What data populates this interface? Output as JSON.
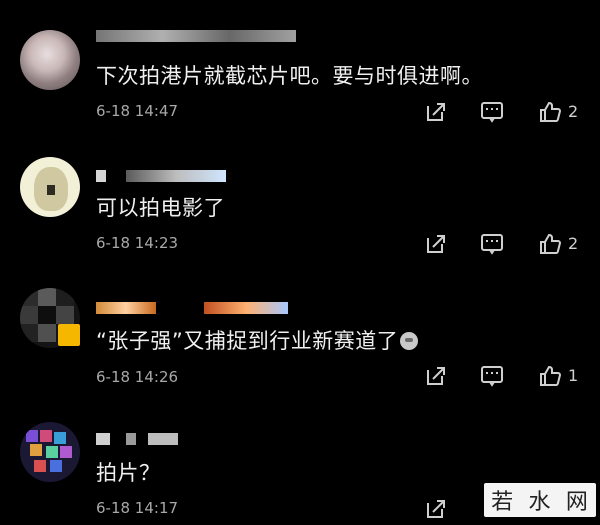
{
  "comments": [
    {
      "avatar": "blurred-avatar",
      "tag": "",
      "text": "下次拍港片就截芯片吧。要与时俱进啊。",
      "time": "6-18 14:47",
      "likes": "2"
    },
    {
      "avatar": "cartoon-avatar",
      "text": "可以拍电影了",
      "time": "6-18 14:23",
      "likes": "2"
    },
    {
      "avatar": "dark-avatar",
      "text": "“张子强”又捕捉到行业新赛道了",
      "time": "6-18 14:26",
      "likes": "1"
    },
    {
      "avatar": "pixel-avatar",
      "text": "拍片？",
      "time": "6-18 14:17",
      "likes": ""
    }
  ],
  "icons": {
    "share": "share-icon",
    "comment": "comment-icon",
    "like": "thumbs-up-icon"
  },
  "watermark": [
    "若",
    "水",
    "网"
  ],
  "colors": {
    "background": "#000000",
    "text": "#f0f0f0",
    "time": "#a8a8a8",
    "tag": "#4a90e2",
    "vip": "#f5b700"
  }
}
